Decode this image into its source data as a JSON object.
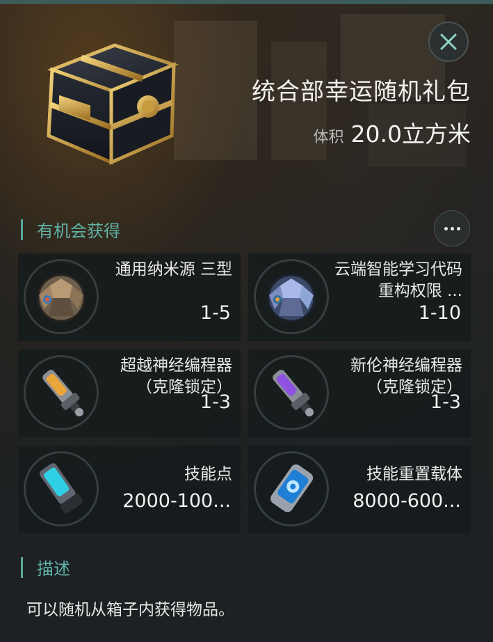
{
  "header": {
    "title": "统合部幸运随机礼包",
    "volume_label": "体积",
    "volume_value": "20.0立方米"
  },
  "rewards_section": {
    "title": "有机会获得",
    "items": [
      {
        "name": "通用纳米源 三型",
        "qty": "1-5",
        "icon": "nanite-orb-bronze-icon"
      },
      {
        "name": "云端智能学习代码重构权限 ...",
        "qty": "1-10",
        "icon": "nanite-orb-blue-icon"
      },
      {
        "name": "超越神经编程器（克隆锁定）",
        "qty": "1-3",
        "icon": "neural-injector-gold-icon"
      },
      {
        "name": "新伦神经编程器（克隆锁定）",
        "qty": "1-3",
        "icon": "neural-injector-purple-icon"
      },
      {
        "name": "技能点",
        "qty": "2000-100...",
        "icon": "skill-point-canister-icon"
      },
      {
        "name": "技能重置载体",
        "qty": "8000-600...",
        "icon": "skill-reset-canister-icon"
      }
    ]
  },
  "description_section": {
    "title": "描述",
    "text": "可以随机从箱子内获得物品。"
  },
  "colors": {
    "accent": "#5fb3a6",
    "top_bar": "#3d5b58",
    "card_bg": "#161b1d"
  }
}
